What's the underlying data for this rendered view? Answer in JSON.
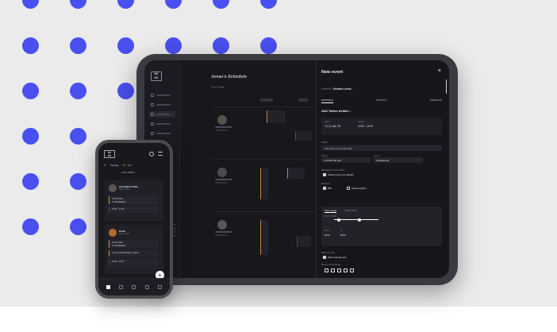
{
  "colors": {
    "background": "#ebebeb",
    "dots": "#4a4ff0",
    "device_frame": "#3a3b40",
    "screen_dark": "#17171c",
    "accent_orange": "#c28a4a"
  },
  "tablet": {
    "schedule_title": "Jonas's Schedule",
    "schedule_date": "Thu, 25 Mar",
    "panel": {
      "title": "New event",
      "close_icon": "×",
      "event_for_label": "Event for:",
      "event_for_value": "Sneaks Lorica",
      "tabs": [
        "TATTOO ●",
        "TATTOO L",
        "PIERCING"
      ],
      "active_tab": 0,
      "add_details_label": "Add Tattoo details  ›",
      "date_label": "Date",
      "date_value": "Tu, 21 Jan, 20",
      "period_label": "Period",
      "period_value": "10:00 - 14:00",
      "client_section": "Client",
      "add_client_label": "Add client and contact data",
      "phone_label": "Phone",
      "phone_value": "+44 304 345 234",
      "email_label": "Email",
      "email_value": "hello@email",
      "message_label": "Message for the client",
      "message_option": "Please bring your data/ID",
      "deposit_label": "Deposit",
      "deposit_value": "€50",
      "deposit_option": "Deposit payed",
      "price_tab_1": "Price range",
      "price_tab_2": "Exact Price",
      "price_range": "€200 - €500",
      "price_from_label": "From",
      "price_from_value": "€100",
      "price_to_label": "To",
      "price_to_value": "€500",
      "internal_label": "Internal note",
      "internal_option": "Write internal note",
      "source_label": "Source of booking"
    }
  },
  "phone": {
    "filter_label": "Tuesday",
    "filter_count": "05 · Mar",
    "date": "Dec 21/25",
    "cards": [
      {
        "name": "Anna Bjornstelle",
        "role": "Tattoo Artist",
        "event_type": "Small Tattoo",
        "event_title": "G. Panatattoos",
        "time": "15:00 - 17:00"
      },
      {
        "name": "Kevin",
        "role": "Tattoo Artist",
        "event_type": "Small Tattoo",
        "event_title": "G. Panatattoos",
        "second_title": "Consult Artist Badges | Busin...",
        "time": "18:00 - 18:30"
      }
    ],
    "fab": "+"
  }
}
